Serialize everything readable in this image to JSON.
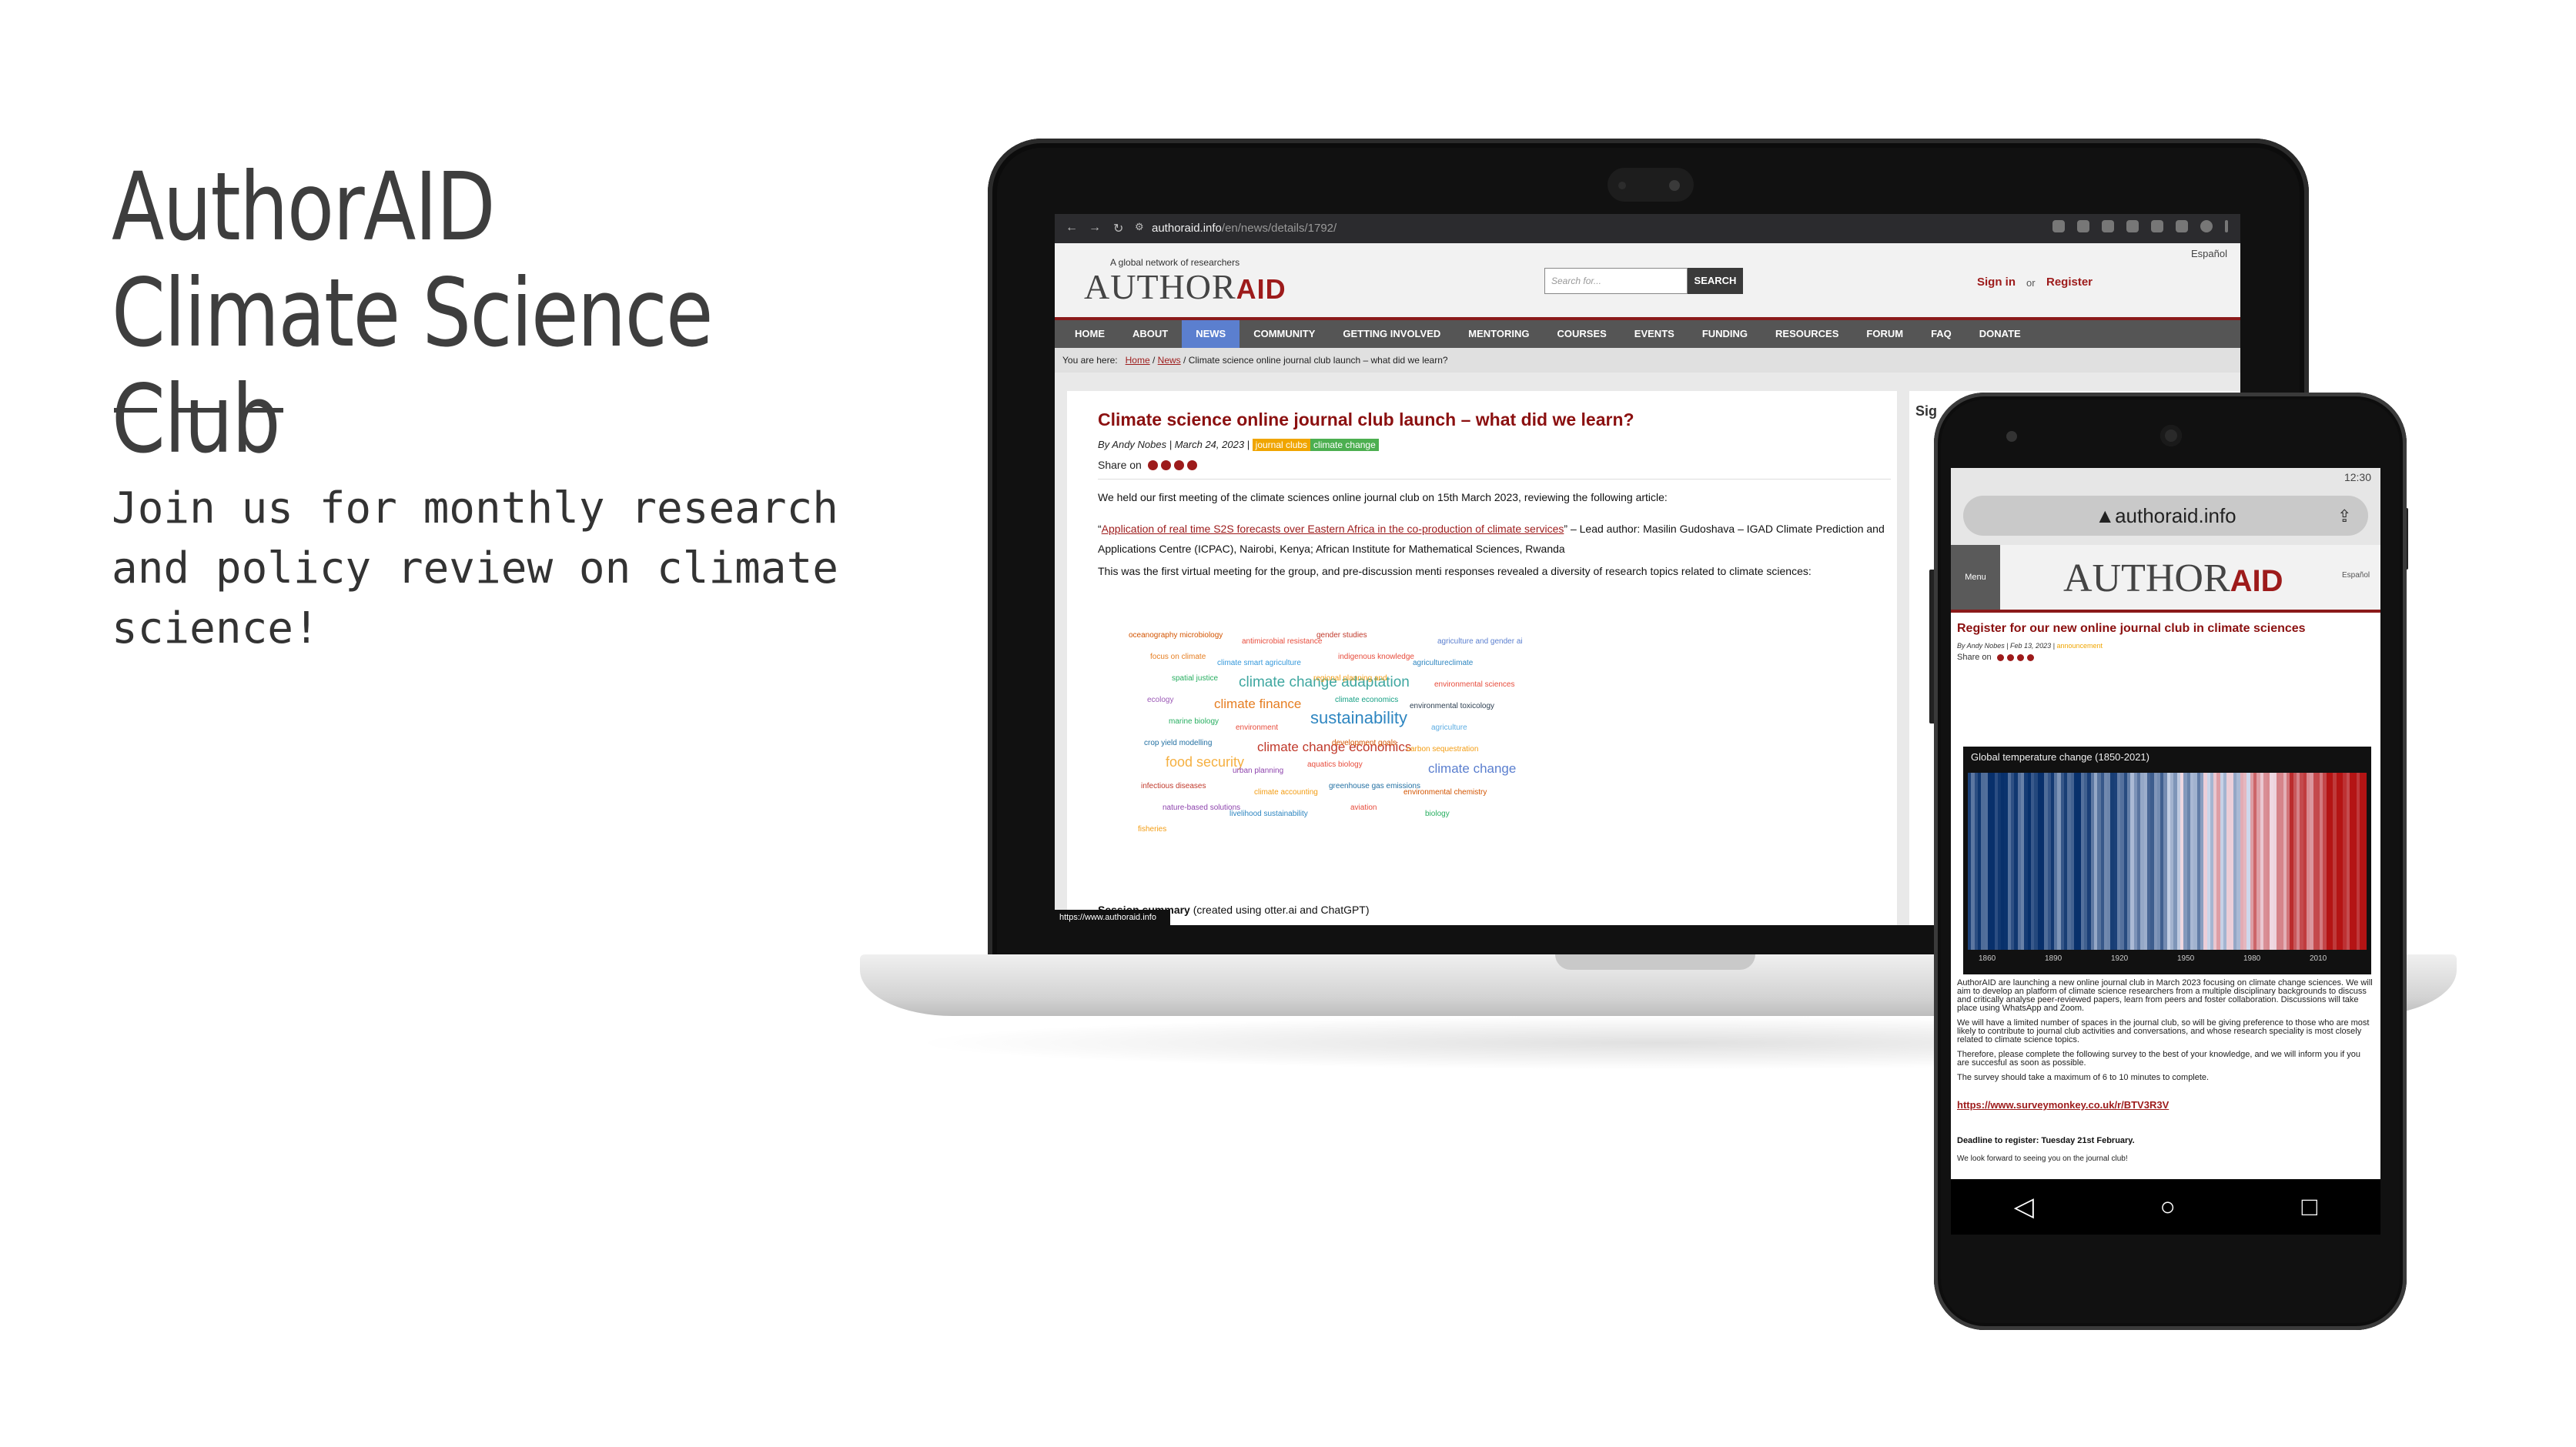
{
  "slide": {
    "title": "AuthorAID Climate Science Club",
    "subtitle": "Join us for monthly research\nand policy review on climate\nscience!"
  },
  "laptop": {
    "browser": {
      "url_host": "authoraid.info",
      "url_path": "/en/news/details/1792/",
      "status_tip": "https://www.authoraid.info"
    },
    "site": {
      "tagline": "A global network of researchers",
      "logo_main": "AUTHOR",
      "logo_bold": "AID",
      "search_placeholder": "Search for...",
      "search_button": "SEARCH",
      "sign_in": "Sign in",
      "or": "or",
      "register": "Register",
      "language": "Español",
      "nav": [
        "HOME",
        "ABOUT",
        "NEWS",
        "COMMUNITY",
        "GETTING INVOLVED",
        "MENTORING",
        "COURSES",
        "EVENTS",
        "FUNDING",
        "RESOURCES",
        "FORUM",
        "FAQ",
        "DONATE"
      ],
      "nav_active": "NEWS",
      "breadcrumb": {
        "prefix": "You are here:",
        "home": "Home",
        "news": "News",
        "current": "Climate science online journal club launch – what did we learn?"
      }
    },
    "article": {
      "title": "Climate science online journal club launch – what did we learn?",
      "meta": "By Andy Nobes | March 24, 2023  |",
      "tags": [
        {
          "label": "journal clubs",
          "color": "#f0a500"
        },
        {
          "label": "climate change",
          "color": "#4caf50"
        }
      ],
      "share_label": "Share on",
      "para1": "We held our first meeting of the climate sciences online journal club on 15th March 2023, reviewing the following article:",
      "para2_link": "Application of real time S2S forecasts over Eastern Africa in the co-production of climate services",
      "para2_rest": "” – Lead author: Masilin Gudoshava – IGAD Climate Prediction and Applications Centre (ICPAC), Nairobi, Kenya; African Institute for Mathematical Sciences, Rwanda",
      "para3": "This was the first virtual meeting for the group, and pre-discussion menti responses revealed a diversity of research topics related to climate sciences:",
      "session_summary_bold": "Session summary",
      "session_summary_rest": " (created using otter.ai and ChatGPT)"
    },
    "wordcloud": [
      {
        "text": "oceanography microbiology",
        "color": "#d35400"
      },
      {
        "text": "antimicrobial resistance",
        "color": "#e74c3c"
      },
      {
        "text": "gender studies",
        "color": "#c0392b"
      },
      {
        "text": "agriculture and gender ai",
        "color": "#5b7fcf"
      },
      {
        "text": "focus on climate",
        "color": "#e67e22"
      },
      {
        "text": "climate smart agriculture",
        "color": "#3498db"
      },
      {
        "text": "indigenous knowledge",
        "color": "#e74c3c"
      },
      {
        "text": "agricultureclimate",
        "color": "#2e86c1"
      },
      {
        "text": "spatial justice",
        "color": "#27ae60"
      },
      {
        "text": "climate change adaptation",
        "color": "#3fa7a0"
      },
      {
        "text": "regional planning and",
        "color": "#f39c12"
      },
      {
        "text": "environmental sciences",
        "color": "#e74c3c"
      },
      {
        "text": "ecology",
        "color": "#9b59b6"
      },
      {
        "text": "climate finance",
        "color": "#e67e22"
      },
      {
        "text": "climate economics",
        "color": "#16a085"
      },
      {
        "text": "environmental toxicology",
        "color": "#2c3e50"
      },
      {
        "text": "marine biology",
        "color": "#27ae60"
      },
      {
        "text": "environment",
        "color": "#e74c3c"
      },
      {
        "text": "sustainability",
        "color": "#2e86c1"
      },
      {
        "text": "agriculture",
        "color": "#5dade2"
      },
      {
        "text": "crop yield modelling",
        "color": "#2471a3"
      },
      {
        "text": "climate change economics",
        "color": "#c0392b"
      },
      {
        "text": "development goals",
        "color": "#d35400"
      },
      {
        "text": "carbon sequestration",
        "color": "#f39c12"
      },
      {
        "text": "food security",
        "color": "#f5b041"
      },
      {
        "text": "urban planning",
        "color": "#8e44ad"
      },
      {
        "text": "aquatics biology",
        "color": "#e74c3c"
      },
      {
        "text": "climate change",
        "color": "#5b7fcf"
      },
      {
        "text": "infectious diseases",
        "color": "#c0392b"
      },
      {
        "text": "climate accounting",
        "color": "#f39c12"
      },
      {
        "text": "greenhouse gas emissions",
        "color": "#2471a3"
      },
      {
        "text": "environmental chemistry",
        "color": "#d35400"
      },
      {
        "text": "nature-based solutions",
        "color": "#8e44ad"
      },
      {
        "text": "livelihood sustainability",
        "color": "#2e86c1"
      },
      {
        "text": "aviation",
        "color": "#e74c3c"
      },
      {
        "text": "biology",
        "color": "#27ae60"
      },
      {
        "text": "fisheries",
        "color": "#f39c12"
      }
    ],
    "sidebar_label": "Sig"
  },
  "phone": {
    "status_time": "12:30",
    "url": "▲authoraid.info",
    "menu": "Menu",
    "logo_main": "AUTHOR",
    "logo_bold": "AID",
    "language": "Español",
    "title": "Register for our new online journal club in climate sciences",
    "meta": "By Andy Nobes | Feb 13, 2023  |",
    "meta_tag": "announcement",
    "share_label": "Share on",
    "stripes_title": "Global temperature change (1850-2021)",
    "years": [
      "1860",
      "1890",
      "1920",
      "1950",
      "1980",
      "2010"
    ],
    "para1": "AuthorAID are launching a new online journal club in March 2023 focusing on climate change sciences. We will aim to develop an platform of climate science researchers from a multiple disciplinary backgrounds to discuss and critically analyse peer-reviewed papers,  learn from peers and foster collaboration. Discussions will take place using WhatsApp and Zoom.",
    "para2": "We will have a limited number of spaces in the journal club, so will be giving preference to those who are most likely to contribute to journal club activities and conversations, and whose research speciality is most closely related to climate science topics.",
    "para3": "Therefore, please complete the following survey to the best of your knowledge, and we will inform you if you are succesful as soon as possible.",
    "para4": "The survey should take a maximum of 6 to 10 minutes to complete.",
    "survey_link": "https://www.surveymonkey.co.uk/r/BTV3R3V",
    "deadline": "Deadline to register: Tuesday 21st February.",
    "look_forward": "We look forward to seeing you on the journal club!",
    "nav_back": "◁",
    "nav_home": "○",
    "nav_recent": "□"
  }
}
